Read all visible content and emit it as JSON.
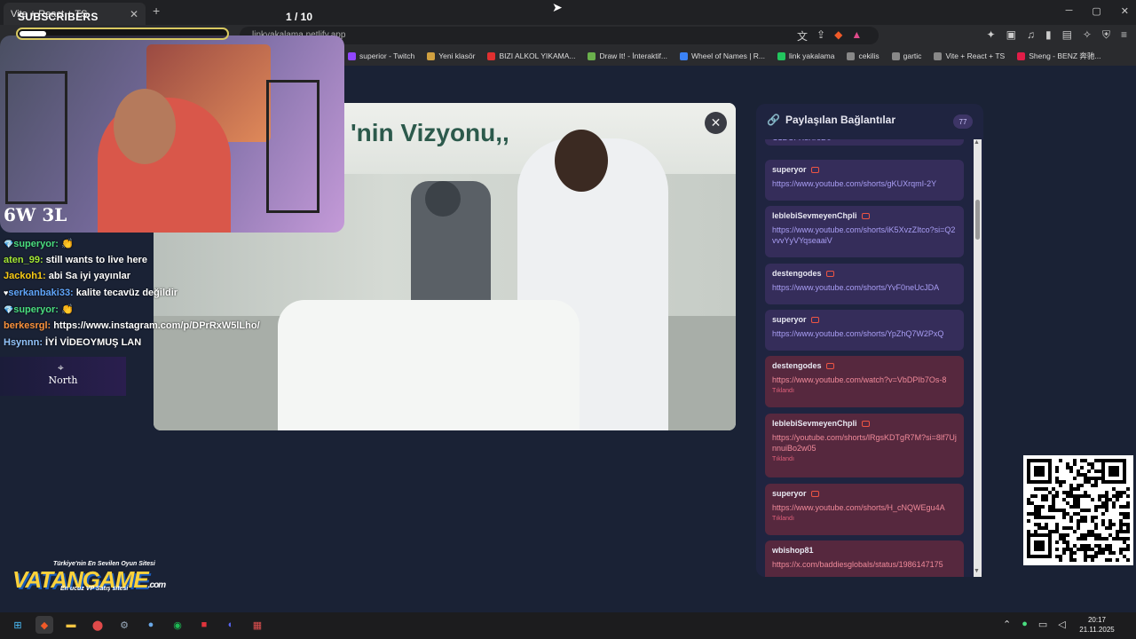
{
  "browser": {
    "tab_title": "Vite + React + TS",
    "new_tab": "+",
    "url": "linkyakalama.netlify.app",
    "window_controls": [
      "─",
      "▢",
      "✕"
    ],
    "bookmarks": [
      {
        "label": "superior - Twitch",
        "color": "#9146ff"
      },
      {
        "label": "Yeni klasör",
        "color": "#d0a040"
      },
      {
        "label": "BIZI ALKOL YIKAMA...",
        "color": "#e03030"
      },
      {
        "label": "Draw It! - İnteraktif...",
        "color": "#6ab04c"
      },
      {
        "label": "Wheel of Names | R...",
        "color": "#3b82f6"
      },
      {
        "label": "link yakalama",
        "color": "#22c55e"
      },
      {
        "label": "cekilis",
        "color": "#888888"
      },
      {
        "label": "gartic",
        "color": "#888888"
      },
      {
        "label": "Vite + React + TS",
        "color": "#888888"
      },
      {
        "label": "Sheng - BENZ 奔驰...",
        "color": "#e11d48"
      }
    ]
  },
  "overlay": {
    "subs_label": "SUBSCRIBERS",
    "subs_count": "1  / 10",
    "subs_progress": 0.1,
    "score": "6W 3L",
    "north_label": "North"
  },
  "chat": [
    {
      "user": "superyor:",
      "msg": "👏",
      "color": "#4ade80",
      "badge": "💎"
    },
    {
      "user": "aten_99:",
      "msg": "still wants to live here",
      "color": "#a3e635",
      "badge": ""
    },
    {
      "user": "Jackoh1:",
      "msg": "abi Sa iyi yayınlar",
      "color": "#facc15",
      "badge": ""
    },
    {
      "user": "serkanbaki33:",
      "msg": "kalite tecavüz değildir",
      "color": "#60a5fa",
      "badge": "♥"
    },
    {
      "user": "superyor:",
      "msg": "👏",
      "color": "#4ade80",
      "badge": "💎"
    },
    {
      "user": "berkesrgl:",
      "msg": "https://www.instagram.com/p/DPrRxW5lLho/",
      "color": "#fb923c",
      "badge": ""
    },
    {
      "user": "Hsynnn:",
      "msg": "İYİ VİDEOYMUŞ LAN",
      "color": "#93c5fd",
      "badge": ""
    }
  ],
  "video": {
    "banner_text": "'nin Vizyonu,,",
    "close": "✕"
  },
  "panel": {
    "title": "Paylaşılan Bağlantılar",
    "count": "77",
    "top_partial": "C1DUFX8Xr6D0",
    "clicked_label": "Tıklandı",
    "items": [
      {
        "user": "superyor",
        "url": "https://www.youtube.com/shorts/gKUXrqmI-2Y",
        "clicked": false,
        "platform": "youtube"
      },
      {
        "user": "leblebiSevmeyenChpli",
        "url": "https://www.youtube.com/shorts/iK5XvzZItco?si=Q2vvvYyVYqseaaiV",
        "clicked": false,
        "platform": "youtube"
      },
      {
        "user": "destengodes",
        "url": "https://www.youtube.com/shorts/YvF0neUcJDA",
        "clicked": false,
        "platform": "youtube"
      },
      {
        "user": "superyor",
        "url": "https://www.youtube.com/shorts/YpZhQ7W2PxQ",
        "clicked": false,
        "platform": "youtube"
      },
      {
        "user": "destengodes",
        "url": "https://www.youtube.com/watch?v=VbDPIb7Os-8",
        "clicked": true,
        "platform": "youtube"
      },
      {
        "user": "leblebiSevmeyenChpli",
        "url": "https://youtube.com/shorts/lRgsKDTgR7M?si=8lf7UjnnuiBo2w05",
        "clicked": true,
        "platform": "youtube"
      },
      {
        "user": "superyor",
        "url": "https://www.youtube.com/shorts/H_cNQWEgu4A",
        "clicked": true,
        "platform": "youtube"
      },
      {
        "user": "wbishop81",
        "url": "https://x.com/baddiesglobals/status/1986147175",
        "clicked": true,
        "platform": "x"
      }
    ]
  },
  "vatan": {
    "top": "Türkiye'nin En Sevilen Oyun Sitesi",
    "main": "VATANGAME",
    "sub": "En ucuz VP Satış sitesi",
    "domain": ".com"
  },
  "taskbar": {
    "time": "20:17",
    "date": "21.11.2025"
  }
}
